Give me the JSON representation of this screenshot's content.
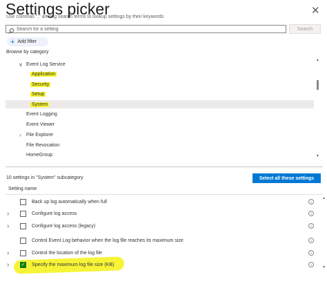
{
  "header": {
    "title": "Settings picker",
    "subtitle": "Use commas \",\" among search terms to lookup settings by their keywords"
  },
  "search": {
    "placeholder": "Search for a setting",
    "button_label": "Search"
  },
  "filter": {
    "add_label": "Add filter"
  },
  "browse": {
    "label": "Browse by category",
    "parent": "Event Log Service",
    "children": [
      "Application",
      "Security",
      "Setup",
      "System"
    ],
    "siblings": [
      "Event Logging",
      "Event Viewer",
      "File Explorer",
      "File Revocation",
      "HomeGroup"
    ]
  },
  "results": {
    "count_label": "10 settings in \"System\" subcategory",
    "select_all_label": "Select all these settings",
    "column_header": "Setting name",
    "settings": [
      {
        "label": "Back up log automatically when full",
        "checked": false,
        "expandable": false
      },
      {
        "label": "Configure log access",
        "checked": false,
        "expandable": true
      },
      {
        "label": "Configure log access (legacy)",
        "checked": false,
        "expandable": true
      },
      {
        "label": "Control Event Log behavior when the log file reaches its maximum size",
        "checked": false,
        "expandable": false
      },
      {
        "label": "Control the location of the log file",
        "checked": false,
        "expandable": true
      },
      {
        "label": "Specify the maximum log file size (KB)",
        "checked": true,
        "expandable": true
      }
    ]
  },
  "icons": {
    "close": "close-icon",
    "search": "search-icon",
    "add": "plus-icon",
    "chevron_down": "chevron-down-icon",
    "chevron_right": "chevron-right-icon",
    "info": "info-icon",
    "check": "checkmark-icon"
  },
  "colors": {
    "accent": "#0078d4",
    "highlight": "#f7f32d",
    "checked": "#107c10"
  }
}
